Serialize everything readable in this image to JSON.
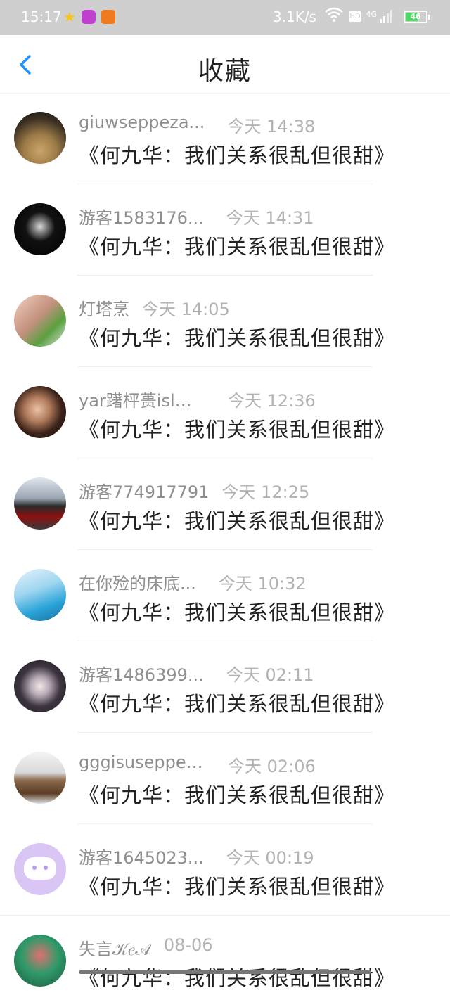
{
  "status_bar": {
    "time": "15:17",
    "speed": "3.1K/s",
    "network": "4G",
    "hd": "HD",
    "battery": "46"
  },
  "header": {
    "title": "收藏",
    "back_icon": "chevron-left-icon"
  },
  "items": [
    {
      "username": "giuwseppeza...",
      "time": "今天 14:38",
      "content": "《何九华：我们关系很乱但很甜》"
    },
    {
      "username": "游客1583176...",
      "time": "今天 14:31",
      "content": "《何九华：我们关系很乱但很甜》"
    },
    {
      "username": "灯塔烹",
      "time": "今天 14:05",
      "content": "《何九华：我们关系很乱但很甜》"
    },
    {
      "username": "yar躇枰蒉isl致...",
      "time": "今天 12:36",
      "content": "《何九华：我们关系很乱但很甜》"
    },
    {
      "username": "游客774917791",
      "time": "今天 12:25",
      "content": "《何九华：我们关系很乱但很甜》"
    },
    {
      "username": "在你殓的床底...",
      "time": "今天 10:32",
      "content": "《何九华：我们关系很乱但很甜》"
    },
    {
      "username": "游客1486399...",
      "time": "今天 02:11",
      "content": "《何九华：我们关系很乱但很甜》"
    },
    {
      "username": "gggisuseppez...",
      "time": "今天 02:06",
      "content": "《何九华：我们关系很乱但很甜》"
    },
    {
      "username": "游客1645023...",
      "time": "今天 00:19",
      "content": "《何九华：我们关系很乱但很甜》"
    },
    {
      "username": "失言𝒦𝑒𝒜",
      "time": "08-06",
      "content": "《何九华：我们关系很乱但很甜》"
    }
  ],
  "colors": {
    "status_bar_bg": "#cfcfcf",
    "accent_blue": "#1e90ff",
    "meta_text": "#a5a5a5",
    "content_text": "#222222"
  }
}
